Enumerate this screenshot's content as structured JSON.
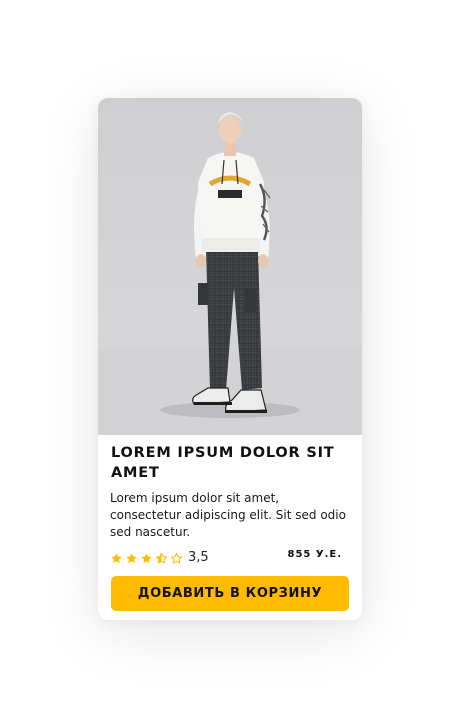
{
  "product": {
    "title": "LOREM IPSUM DOLOR SIT AMET",
    "description": "Lorem ipsum dolor sit amet, consectetur adipiscing elit. Sit sed odio sed nascetur.",
    "rating": {
      "value_label": "3,5",
      "value": 3.5,
      "max": 5,
      "star_color": "#ffbb00"
    },
    "price": "855 У.Е.",
    "image_icon": "product-photo"
  },
  "cart_button": {
    "label": "ДОБАВИТЬ В КОРЗИНУ",
    "color": "#ffbb00"
  }
}
